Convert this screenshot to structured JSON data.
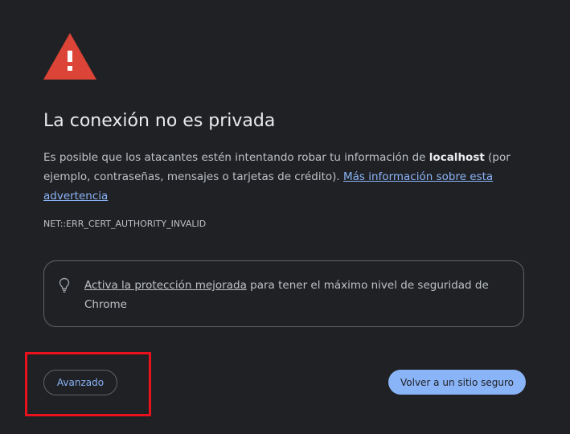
{
  "colors": {
    "background": "#202124",
    "warning_red": "#db4437",
    "link_blue": "#8ab4f8",
    "text": "#bdc1c6",
    "highlight_red": "#e8111c"
  },
  "icons": {
    "warning": "warning-triangle-icon",
    "bulb": "lightbulb-icon"
  },
  "title": "La conexión no es privada",
  "explanation": {
    "text_before": "Es posible que los atacantes estén intentando robar tu información de ",
    "host": "localhost",
    "text_after": " (por ejemplo, contraseñas, mensajes o tarjetas de crédito). ",
    "learn_more_link": "Más información sobre esta advertencia"
  },
  "error_code": "NET::ERR_CERT_AUTHORITY_INVALID",
  "enhanced_protection": {
    "link": "Activa la protección mejorada",
    "text": " para tener el máximo nivel de seguridad de Chrome"
  },
  "buttons": {
    "advanced": "Avanzado",
    "back_to_safety": "Volver a un sitio seguro"
  }
}
